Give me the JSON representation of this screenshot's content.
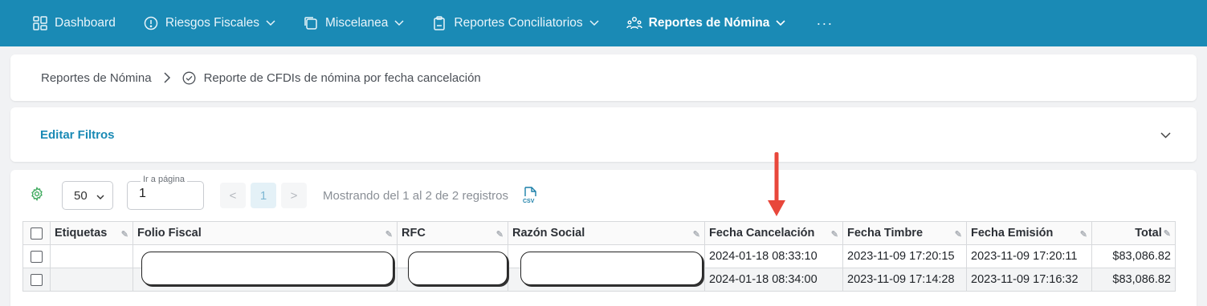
{
  "nav": {
    "items": [
      {
        "label": "Dashboard",
        "icon": "dashboard-grid-icon",
        "chevron": false,
        "active": false
      },
      {
        "label": "Riesgos Fiscales",
        "icon": "alert-circle-icon",
        "chevron": true,
        "active": false
      },
      {
        "label": "Miscelanea",
        "icon": "copy-squares-icon",
        "chevron": true,
        "active": false
      },
      {
        "label": "Reportes Conciliatorios",
        "icon": "clipboard-icon",
        "chevron": true,
        "active": false
      },
      {
        "label": "Reportes de Nómina",
        "icon": "users-group-icon",
        "chevron": true,
        "active": true
      }
    ],
    "more_label": "···"
  },
  "breadcrumb": {
    "parent": "Reportes de Nómina",
    "current": "Reporte de CFDIs de nómina por fecha cancelación"
  },
  "filters": {
    "label": "Editar Filtros"
  },
  "toolbar": {
    "page_size": "50",
    "goto_label": "Ir a página",
    "goto_value": "1",
    "prev": "<",
    "current_page": "1",
    "next": ">",
    "showing": "Mostrando del 1 al 2 de 2 registros",
    "export_icon": "csv-file-icon",
    "settings_icon": "gear-icon"
  },
  "table": {
    "columns": [
      "",
      "Etiquetas",
      "Folio Fiscal",
      "RFC",
      "Razón Social",
      "Fecha Cancelación",
      "Fecha Timbre",
      "Fecha Emisión",
      "Total"
    ],
    "rows": [
      {
        "etiquetas": "",
        "folio": "",
        "rfc": "",
        "razon": "",
        "cancelacion": "2024-01-18 08:33:10",
        "timbre": "2023-11-09 17:20:15",
        "emision": "2023-11-09 17:20:11",
        "total": "$83,086.82"
      },
      {
        "etiquetas": "",
        "folio": "",
        "rfc": "",
        "razon": "",
        "cancelacion": "2024-01-18 08:34:00",
        "timbre": "2023-11-09 17:14:28",
        "emision": "2023-11-09 17:16:32",
        "total": "$83,086.82"
      }
    ]
  },
  "colors": {
    "nav_bg": "#1a8ab5",
    "accent": "#1a8ab5",
    "annotation_arrow": "#e8473b"
  }
}
